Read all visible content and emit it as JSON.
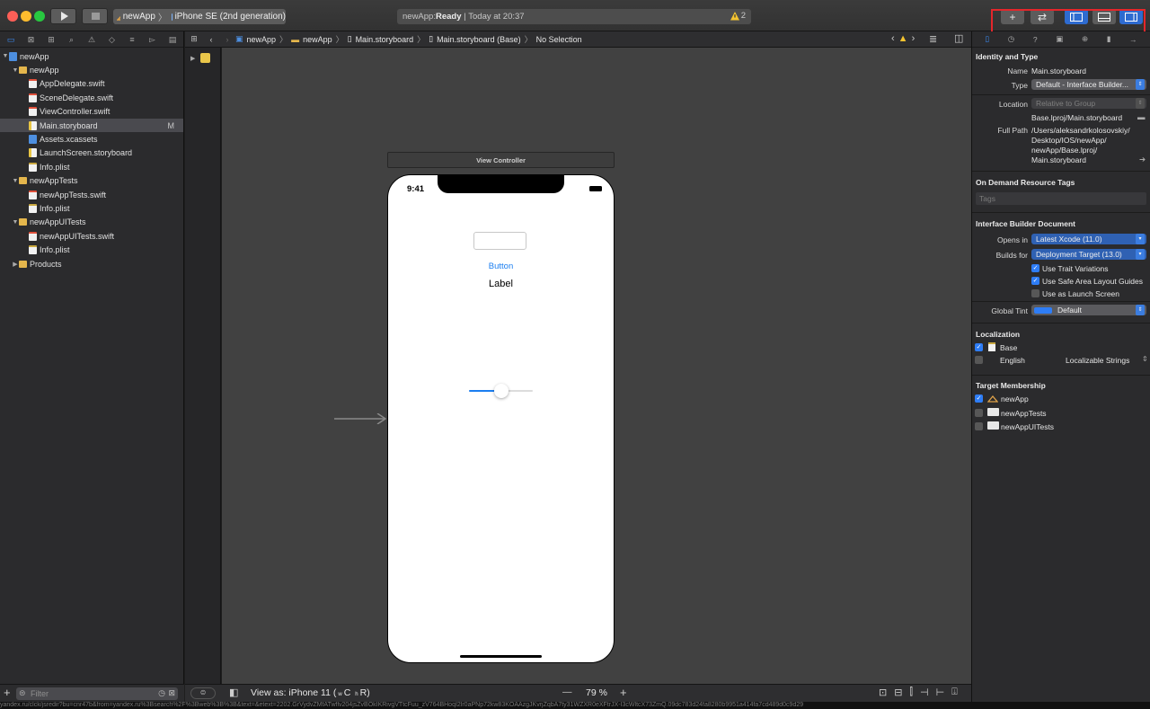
{
  "toolbar": {
    "scheme_target": "newApp",
    "device": "iPhone SE (2nd generation)",
    "activity_prefix": "newApp: ",
    "activity_status": "Ready",
    "activity_separator": " | ",
    "activity_time": "Today at 20:37",
    "warning_count": "2",
    "colors": {
      "close": "#fe5f57",
      "minimize": "#febc2e",
      "zoom": "#28c840",
      "highlight": "#e4262b"
    }
  },
  "navigator": {
    "items": [
      {
        "label": "newApp",
        "icon": "project-icon",
        "level": 0
      },
      {
        "label": "newApp",
        "icon": "folder-icon",
        "level": 1
      },
      {
        "label": "AppDelegate.swift",
        "icon": "swift-file-icon",
        "level": 2
      },
      {
        "label": "SceneDelegate.swift",
        "icon": "swift-file-icon",
        "level": 2
      },
      {
        "label": "ViewController.swift",
        "icon": "swift-file-icon",
        "level": 2
      },
      {
        "label": "Main.storyboard",
        "icon": "storyboard-file-icon",
        "level": 2,
        "badge": "M",
        "selected": true
      },
      {
        "label": "Assets.xcassets",
        "icon": "assets-icon",
        "level": 2
      },
      {
        "label": "LaunchScreen.storyboard",
        "icon": "storyboard-file-icon",
        "level": 2
      },
      {
        "label": "Info.plist",
        "icon": "plist-file-icon",
        "level": 2
      },
      {
        "label": "newAppTests",
        "icon": "folder-icon",
        "level": 1
      },
      {
        "label": "newAppTests.swift",
        "icon": "swift-file-icon",
        "level": 2
      },
      {
        "label": "Info.plist",
        "icon": "plist-file-icon",
        "level": 2
      },
      {
        "label": "newAppUITests",
        "icon": "folder-icon",
        "level": 1
      },
      {
        "label": "newAppUITests.swift",
        "icon": "swift-file-icon",
        "level": 2
      },
      {
        "label": "Info.plist",
        "icon": "plist-file-icon",
        "level": 2
      },
      {
        "label": "Products",
        "icon": "folder-icon",
        "level": 1,
        "collapsed": true
      }
    ],
    "filter_placeholder": "Filter"
  },
  "jumpbar": {
    "crumbs": [
      "newApp",
      "newApp",
      "Main.storyboard",
      "Main.storyboard (Base)",
      "No Selection"
    ]
  },
  "canvas": {
    "scene_title": "View Controller",
    "status_time": "9:41",
    "button_label": "Button",
    "label_text": "Label",
    "slider_value": 0.5,
    "view_as": "View as: iPhone 11 (",
    "view_as_suffix": "C",
    "view_as_end": "R)",
    "zoom": "79 %",
    "zoom_minus": "—",
    "zoom_plus": "+"
  },
  "inspector": {
    "identity_title": "Identity and Type",
    "name_label": "Name",
    "name_value": "Main.storyboard",
    "type_label": "Type",
    "type_value": "Default - Interface Builder...",
    "location_label": "Location",
    "location_value": "Relative to Group",
    "location_path": "Base.lproj/Main.storyboard",
    "full_path_label": "Full Path",
    "full_path_lines": [
      "/Users/aleksandrkolosovskiy/",
      "Desktop/IOS/newApp/",
      "newApp/Base.lproj/",
      "Main.storyboard"
    ],
    "odr_title": "On Demand Resource Tags",
    "tags_placeholder": "Tags",
    "ib_title": "Interface Builder Document",
    "opens_in_label": "Opens in",
    "opens_in_value": "Latest Xcode (11.0)",
    "builds_for_label": "Builds for",
    "builds_for_value": "Deployment Target (13.0)",
    "options": [
      {
        "label": "Use Trait Variations",
        "checked": true
      },
      {
        "label": "Use Safe Area Layout Guides",
        "checked": true
      },
      {
        "label": "Use as Launch Screen",
        "checked": false
      }
    ],
    "global_tint_label": "Global Tint",
    "global_tint_value": "Default",
    "localization_title": "Localization",
    "localizations": [
      {
        "label": "Base",
        "checked": true,
        "extra": ""
      },
      {
        "label": "English",
        "checked": false,
        "extra": "Localizable Strings"
      }
    ],
    "target_title": "Target Membership",
    "targets": [
      {
        "label": "newApp",
        "checked": true
      },
      {
        "label": "newAppTests",
        "checked": false
      },
      {
        "label": "newAppUITests",
        "checked": false
      }
    ],
    "tint_color": "#2e7df6"
  },
  "status_url": "yandex.ru/clck/jsredir?bu=cnr47b&from=yandex.ru%3Bsearch%2F%3Bweb%3B%3B&text=&etext=2202.GrVydvZMfATwflv204jsZvBOkIKRivgVTtcFuu_zV764BHoqI2lr0aPNp72kw83KOAAzgJKvrjZqbA7ty31WZXR0eXFtrJX-I3cWltcX73ZmQ.09dc783d24fa8280b9951a414fa7cd489d0c9d29"
}
